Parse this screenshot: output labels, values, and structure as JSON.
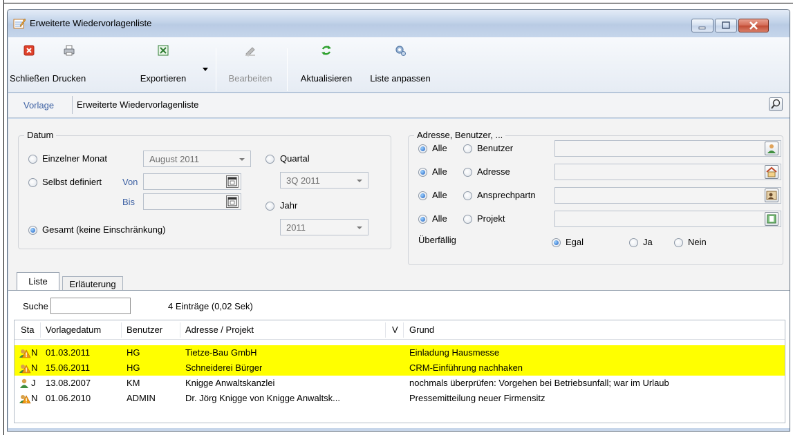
{
  "window": {
    "title": "Erweiterte Wiedervorlagenliste"
  },
  "toolbar": {
    "close_label": "Schließen",
    "print_label": "Drucken",
    "export_label": "Exportieren",
    "edit_label": "Bearbeiten",
    "refresh_label": "Aktualisieren",
    "customize_label": "Liste anpassen"
  },
  "vorlage": {
    "label": "Vorlage",
    "value": "Erweiterte Wiedervorlagenliste"
  },
  "datum": {
    "legend": "Datum",
    "single_month_label": "Einzelner Monat",
    "single_month_value": "August 2011",
    "custom_label": "Selbst definiert",
    "from_label": "Von",
    "to_label": "Bis",
    "total_label": "Gesamt (keine Einschränkung)",
    "quarter_label": "Quartal",
    "quarter_value": "3Q  2011",
    "year_label": "Jahr",
    "year_value": "2011",
    "selected": "Gesamt (keine Einschränkung)"
  },
  "adresse": {
    "legend": "Adresse, Benutzer, ...",
    "all_label": "Alle",
    "rows": [
      {
        "label": "Benutzer"
      },
      {
        "label": "Adresse"
      },
      {
        "label": "Ansprechpartn"
      },
      {
        "label": "Projekt"
      }
    ],
    "overdue_label": "Überfällig",
    "overdue_options": [
      "Egal",
      "Ja",
      "Nein"
    ],
    "overdue_selected": "Egal"
  },
  "tabs": [
    "Liste",
    "Erläuterung"
  ],
  "list": {
    "search_label": "Suche",
    "search_value": "",
    "count_text": "4 Einträge (0,02 Sek)",
    "columns": [
      "Sta",
      "Vorlagedatum",
      "Benutzer",
      "Adresse / Projekt",
      "V",
      "Grund"
    ],
    "rows": [
      {
        "status_icon": "warning-person-icon",
        "status": "N",
        "date": "01.03.2011",
        "user": "HG",
        "address": "Tietze-Bau GmbH",
        "v": "",
        "reason": "Einladung Hausmesse",
        "highlight": true
      },
      {
        "status_icon": "warning-person-icon",
        "status": "N",
        "date": "15.06.2011",
        "user": "HG",
        "address": "Schneiderei Bürger",
        "v": "",
        "reason": "CRM-Einführung nachhaken",
        "highlight": true
      },
      {
        "status_icon": "person-ok-icon",
        "status": "J",
        "date": "13.08.2007",
        "user": "KM",
        "address": "Knigge Anwaltskanzlei",
        "v": "",
        "reason": "nochmals überprüfen: Vorgehen bei Betriebsunfall; war im Urlaub",
        "highlight": false
      },
      {
        "status_icon": "warning-person-icon",
        "status": "N",
        "date": "01.06.2010",
        "user": "ADMIN",
        "address": "Dr. Jörg Knigge von Knigge Anwaltsk...",
        "v": "",
        "reason": "Pressemitteilung neuer Firmensitz",
        "highlight": false
      }
    ]
  },
  "colors": {
    "highlight": "#ffff00",
    "accent": "#3b5fa2"
  }
}
